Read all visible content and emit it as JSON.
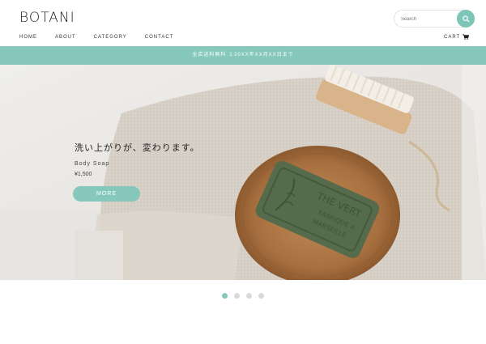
{
  "header": {
    "logo": "BOTANI",
    "search": {
      "placeholder": "Search",
      "value": ""
    },
    "nav": [
      "HOME",
      "ABOUT",
      "CATEGORY",
      "CONTACT"
    ],
    "cart_label": "CART"
  },
  "banner": {
    "text": "全店送料無料 １20XX年XX月XX日まで"
  },
  "hero": {
    "title": "洗い上がりが、変わります。",
    "product_name": "Body Soap",
    "price": "¥1,500",
    "button_label": "MORE",
    "soap_text_1": "THE VERT",
    "soap_text_2": "FABRIQUE A",
    "soap_text_3": "MARSEILLE"
  },
  "carousel": {
    "slide_count": 4,
    "active_index": 0
  },
  "colors": {
    "accent": "#86c8bb",
    "accent_dark": "#7cc5b7",
    "text": "#333333"
  }
}
